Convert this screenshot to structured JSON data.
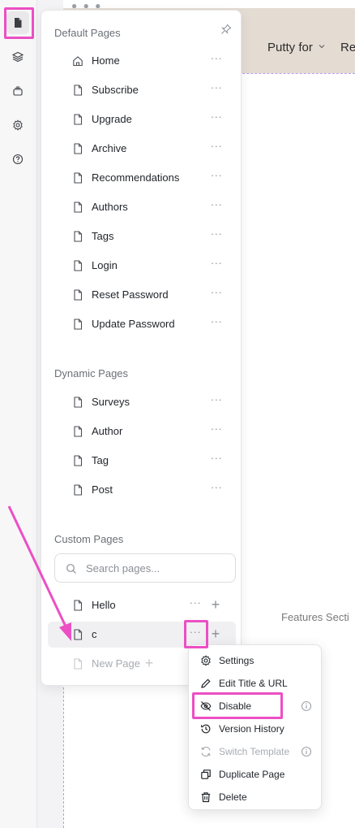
{
  "canvas": {
    "nav_items": [
      "Putty for",
      "Re"
    ],
    "features_text": "Features Secti"
  },
  "rail": {
    "items": [
      {
        "icon": "page-icon",
        "active": true
      },
      {
        "icon": "layers-icon",
        "active": false
      },
      {
        "icon": "stack-icon",
        "active": false
      },
      {
        "icon": "gear-icon",
        "active": false
      },
      {
        "icon": "help-icon",
        "active": false
      }
    ]
  },
  "panel": {
    "default_title": "Default Pages",
    "default_pages": [
      {
        "label": "Home",
        "icon": "home-icon"
      },
      {
        "label": "Subscribe",
        "icon": "page-icon"
      },
      {
        "label": "Upgrade",
        "icon": "page-icon"
      },
      {
        "label": "Archive",
        "icon": "page-icon"
      },
      {
        "label": "Recommendations",
        "icon": "page-icon"
      },
      {
        "label": "Authors",
        "icon": "page-icon"
      },
      {
        "label": "Tags",
        "icon": "page-icon"
      },
      {
        "label": "Login",
        "icon": "page-icon"
      },
      {
        "label": "Reset Password",
        "icon": "page-icon"
      },
      {
        "label": "Update Password",
        "icon": "page-icon"
      }
    ],
    "dynamic_title": "Dynamic Pages",
    "dynamic_pages": [
      {
        "label": "Surveys"
      },
      {
        "label": "Author"
      },
      {
        "label": "Tag"
      },
      {
        "label": "Post"
      }
    ],
    "custom_title": "Custom Pages",
    "search_placeholder": "Search pages...",
    "custom_pages": [
      {
        "label": "Hello"
      },
      {
        "label": "c"
      }
    ],
    "new_page_label": "New Page",
    "more_glyph": "···",
    "plus_glyph": "+"
  },
  "context_menu": {
    "items": [
      {
        "label": "Settings",
        "icon": "gear-icon",
        "disabled": false
      },
      {
        "label": "Edit Title & URL",
        "icon": "pencil-icon",
        "disabled": false
      },
      {
        "label": "Disable",
        "icon": "eye-off-icon",
        "disabled": false,
        "info": true
      },
      {
        "label": "Version History",
        "icon": "history-icon",
        "disabled": false
      },
      {
        "label": "Switch Template",
        "icon": "switch-icon",
        "disabled": true,
        "info": true
      },
      {
        "label": "Duplicate Page",
        "icon": "duplicate-icon",
        "disabled": false
      },
      {
        "label": "Delete",
        "icon": "trash-icon",
        "disabled": false
      }
    ]
  },
  "colors": {
    "highlight": "#ec4fc4",
    "canvas_header": "#e4dcd3",
    "guide": "#b49cf0"
  }
}
